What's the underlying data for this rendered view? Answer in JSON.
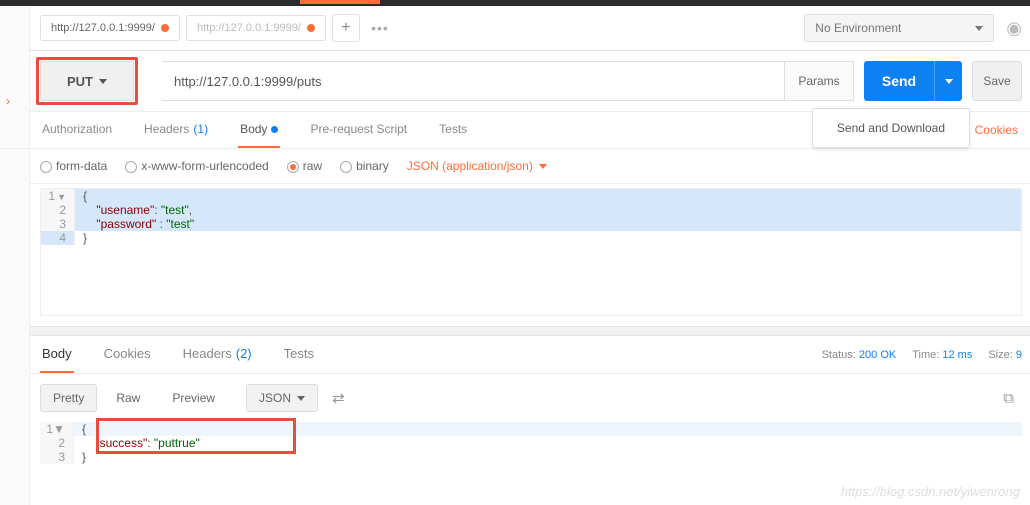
{
  "tabs": [
    {
      "label": "http://127.0.0.1:9999/",
      "active": true
    },
    {
      "label": "http://127.0.0.1:9999/",
      "active": false
    }
  ],
  "environment": {
    "label": "No Environment"
  },
  "request": {
    "method": "PUT",
    "url": "http://127.0.0.1:9999/puts",
    "params_btn": "Params",
    "send_btn": "Send",
    "save_btn": "Save",
    "send_download": "Send and Download"
  },
  "request_tabs": {
    "authorization": "Authorization",
    "headers": "Headers",
    "headers_count": "(1)",
    "body": "Body",
    "prerequest": "Pre-request Script",
    "tests": "Tests",
    "cookies": "Cookies"
  },
  "body_options": {
    "form_data": "form-data",
    "urlencoded": "x-www-form-urlencoded",
    "raw": "raw",
    "binary": "binary",
    "content_type": "JSON (application/json)"
  },
  "request_body": {
    "lines": [
      "1",
      "2",
      "3",
      "4"
    ],
    "l1": "{",
    "l2_key": "\"usename\"",
    "l2_sep": ": ",
    "l2_val": "\"test\"",
    "l2_end": ",",
    "l3_key": "\"password\"",
    "l3_sep": " : ",
    "l3_val": "\"test\"",
    "l4": "}"
  },
  "response_tabs": {
    "body": "Body",
    "cookies": "Cookies",
    "headers": "Headers",
    "headers_count": "(2)",
    "tests": "Tests"
  },
  "response_meta": {
    "status_label": "Status:",
    "status_value": "200 OK",
    "time_label": "Time:",
    "time_value": "12 ms",
    "size_label": "Size:",
    "size_value": "9"
  },
  "response_toolbar": {
    "pretty": "Pretty",
    "raw": "Raw",
    "preview": "Preview",
    "format": "JSON"
  },
  "response_body": {
    "lines": [
      "1",
      "2",
      "3"
    ],
    "l1": "{",
    "l2_key": "\"success\"",
    "l2_sep": ": ",
    "l2_val": "\"puttrue\"",
    "l3": "}"
  },
  "watermark": "https://blog.csdn.net/yiwenrong"
}
